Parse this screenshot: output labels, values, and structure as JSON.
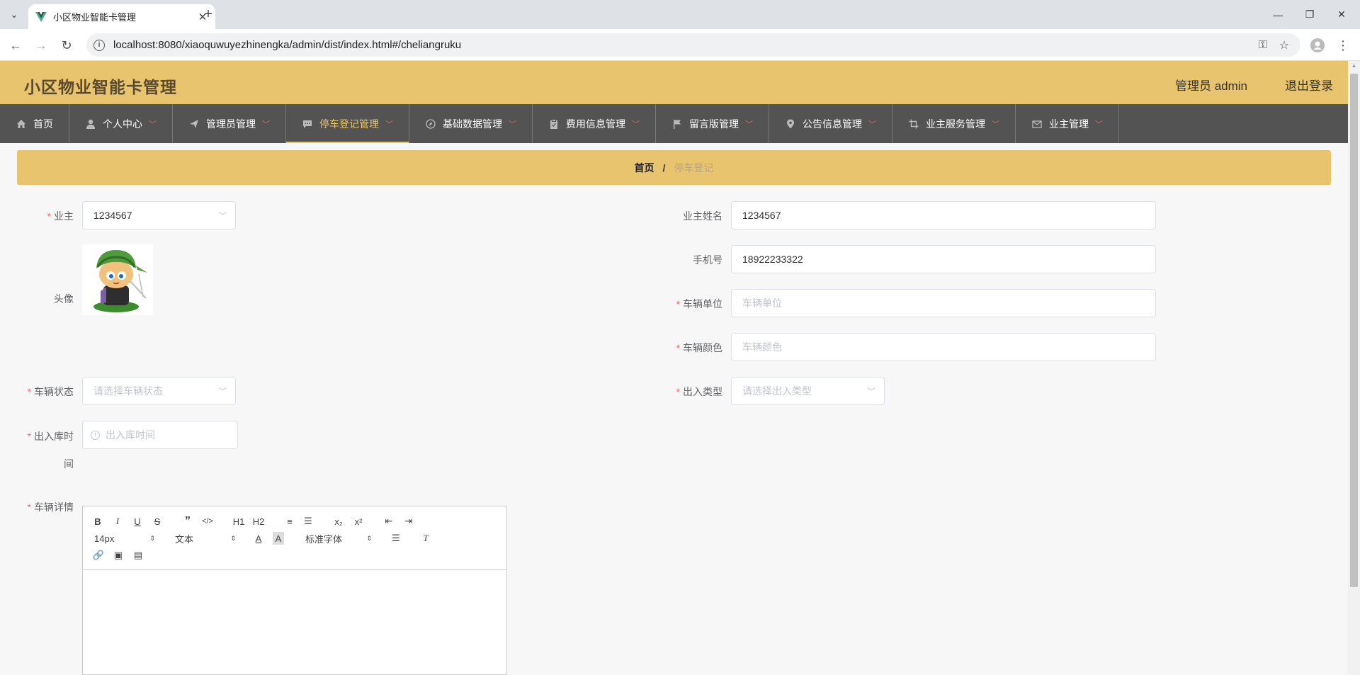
{
  "browser": {
    "tab_title": "小区物业智能卡管理",
    "url": "localhost:8080/xiaoquwuyezhinengka/admin/dist/index.html#/cheliangruku"
  },
  "header": {
    "app_title": "小区物业智能卡管理",
    "admin_label": "管理员 admin",
    "logout_label": "退出登录"
  },
  "menu": [
    {
      "label": "首页",
      "icon": "home-icon",
      "has_caret": false
    },
    {
      "label": "个人中心",
      "icon": "user-icon",
      "has_caret": true
    },
    {
      "label": "管理员管理",
      "icon": "send-icon",
      "has_caret": true
    },
    {
      "label": "停车登记管理",
      "icon": "chat-icon",
      "has_caret": true,
      "active": true
    },
    {
      "label": "基础数据管理",
      "icon": "compass-icon",
      "has_caret": true
    },
    {
      "label": "费用信息管理",
      "icon": "clipboard-icon",
      "has_caret": true
    },
    {
      "label": "留言版管理",
      "icon": "flag-icon",
      "has_caret": true
    },
    {
      "label": "公告信息管理",
      "icon": "location-icon",
      "has_caret": true
    },
    {
      "label": "业主服务管理",
      "icon": "crop-icon",
      "has_caret": true
    },
    {
      "label": "业主管理",
      "icon": "mail-icon",
      "has_caret": true
    }
  ],
  "breadcrumb": {
    "home": "首页",
    "separator": "/",
    "current": "停车登记"
  },
  "form": {
    "owner_label": "业主",
    "owner_value": "1234567",
    "owner_name_label": "业主姓名",
    "owner_name_value": "1234567",
    "avatar_label": "头像",
    "phone_label": "手机号",
    "phone_value": "18922233322",
    "vehicle_unit_label": "车辆单位",
    "vehicle_unit_placeholder": "车辆单位",
    "vehicle_color_label": "车辆颜色",
    "vehicle_color_placeholder": "车辆颜色",
    "vehicle_status_label": "车辆状态",
    "vehicle_status_placeholder": "请选择车辆状态",
    "inout_type_label": "出入类型",
    "inout_type_placeholder": "请选择出入类型",
    "inout_time_label_1": "出入库时",
    "inout_time_label_2": "间",
    "inout_time_placeholder": "出入库时间",
    "detail_label": "车辆详情"
  },
  "editor": {
    "font_size": "14px",
    "block_type": "文本",
    "font_family": "标准字体",
    "h1": "H1",
    "h2": "H2",
    "sub": "x₂",
    "sup": "x²"
  },
  "colors": {
    "header_bg": "#e7c46d",
    "menu_bg": "#535353",
    "active_menu": "#e7c46d",
    "required": "#f56c6c"
  }
}
